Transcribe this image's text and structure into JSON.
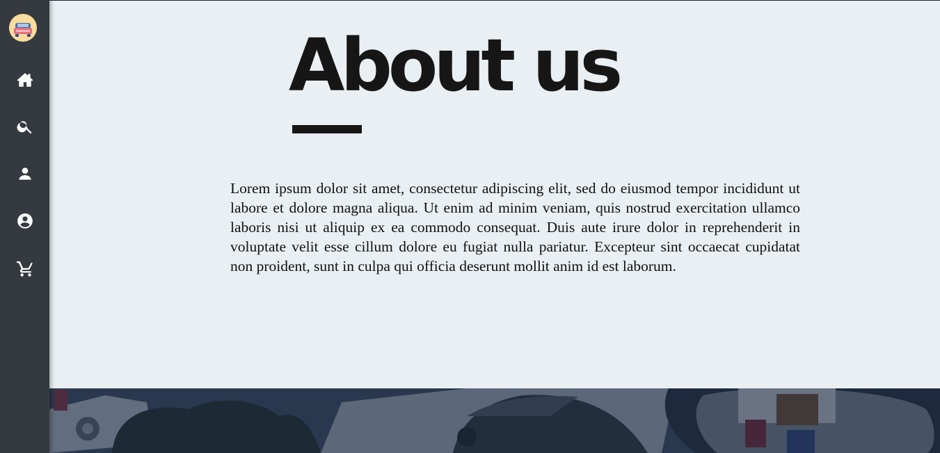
{
  "sidebar": {
    "logo_icon": "car-logo-icon",
    "items": [
      {
        "name": "home",
        "icon": "home-icon"
      },
      {
        "name": "search",
        "icon": "search-icon"
      },
      {
        "name": "user",
        "icon": "person-icon"
      },
      {
        "name": "account",
        "icon": "account-circle-icon"
      },
      {
        "name": "cart",
        "icon": "cart-icon"
      }
    ]
  },
  "main": {
    "title": "About us",
    "body": "Lorem ipsum dolor sit amet, consectetur adipiscing elit, sed do eiusmod tempor incididunt ut labore et dolore magna aliqua. Ut enim ad minim veniam, quis nostrud exercitation ullamco laboris nisi ut aliquip ex ea commodo consequat. Duis aute irure dolor in reprehenderit in voluptate velit esse cillum dolore eu fugiat nulla pariatur. Excepteur sint occaecat cupidatat non proident, sunt in culpa qui officia deserunt mollit anim id est laborum."
  },
  "colors": {
    "sidebar_bg": "#353a40",
    "page_bg": "#e9eff2",
    "text": "#161616",
    "banner_tint": "#1b2a44"
  }
}
